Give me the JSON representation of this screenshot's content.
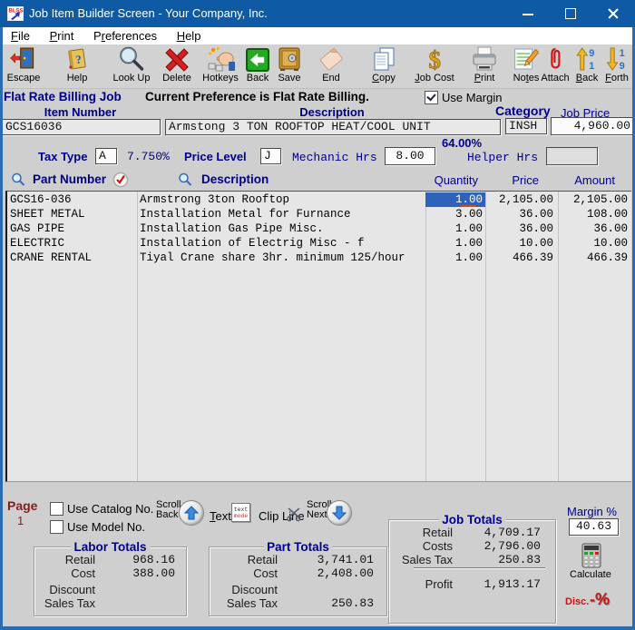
{
  "titlebar": {
    "icon_text": "BLSS",
    "title": "Job Item Builder Screen - Your Company, Inc."
  },
  "menubar": {
    "items": [
      {
        "pre": "",
        "u": "F",
        "post": "ile"
      },
      {
        "pre": "",
        "u": "P",
        "post": "rint"
      },
      {
        "pre": "P",
        "u": "r",
        "post": "eferences"
      },
      {
        "pre": "",
        "u": "H",
        "post": "elp"
      }
    ]
  },
  "toolbar": {
    "items": [
      {
        "icon": "escape-door",
        "pre": "Escape",
        "u": "",
        "post": ""
      },
      {
        "icon": "help-book",
        "pre": "Help",
        "u": "",
        "post": ""
      },
      {
        "icon": "magnifier",
        "pre": "Look Up",
        "u": "",
        "post": ""
      },
      {
        "icon": "delete-x",
        "pre": "Delete",
        "u": "",
        "post": ""
      },
      {
        "icon": "hotkeys-hand",
        "pre": "Hotkeys",
        "u": "",
        "post": ""
      },
      {
        "icon": "back-green-arrow",
        "pre": "Back",
        "u": "",
        "post": ""
      },
      {
        "icon": "safe",
        "pre": "Save",
        "u": "",
        "post": ""
      },
      {
        "icon": "end-page",
        "pre": "End",
        "u": "",
        "post": ""
      },
      {
        "icon": "copy-docs",
        "pre": "",
        "u": "C",
        "post": "opy"
      },
      {
        "icon": "dollar",
        "pre": "",
        "u": "J",
        "post": "ob Cost"
      },
      {
        "icon": "printer",
        "pre": "",
        "u": "P",
        "post": "rint"
      },
      {
        "icon": "notes-pad",
        "pre": "No",
        "u": "t",
        "post": "es"
      },
      {
        "icon": "paperclip",
        "pre": "Attach",
        "u": "",
        "post": ""
      },
      {
        "icon": "numeric-up",
        "pre": "",
        "u": "B",
        "post": "ack"
      },
      {
        "icon": "numeric-down",
        "pre": "",
        "u": "F",
        "post": "orth"
      }
    ]
  },
  "banner": {
    "mode": "Flat Rate Billing Job",
    "message": "Current Preference is Flat Rate Billing.",
    "use_margin_label": "Use Margin",
    "use_margin_checked": true
  },
  "item": {
    "item_number_label": "Item Number",
    "item_number": "GCS16036",
    "description_label": "Description",
    "description": "Armstong 3 TON ROOFTOP HEAT/COOL UNIT",
    "category_label": "Category",
    "category": "INSH",
    "job_price_label": "Job Price",
    "job_price": "4,960.00",
    "margin_pct": "64.00%",
    "tax_type_label": "Tax Type",
    "tax_type": "A",
    "tax_rate": "7.750%",
    "price_level_label": "Price Level",
    "price_level": "J",
    "mechanic_hrs_label": "Mechanic Hrs",
    "mechanic_hrs": "8.00",
    "helper_hrs_label": "Helper Hrs",
    "helper_hrs": ""
  },
  "table": {
    "headers": {
      "part": "Part Number",
      "desc": "Description",
      "qty": "Quantity",
      "price": "Price",
      "amount": "Amount"
    },
    "rows": [
      {
        "part": "GCS16-036",
        "desc": "Armstrong 3ton Rooftop",
        "qty": "1.00",
        "price": "2,105.00",
        "amount": "2,105.00",
        "selected": true
      },
      {
        "part": "SHEET METAL",
        "desc": "Installation Metal for Furnance",
        "qty": "3.00",
        "price": "36.00",
        "amount": "108.00",
        "selected": false
      },
      {
        "part": "GAS PIPE",
        "desc": "Installation Gas Pipe Misc.",
        "qty": "1.00",
        "price": "36.00",
        "amount": "36.00",
        "selected": false
      },
      {
        "part": "ELECTRIC",
        "desc": "Installation of Electrig Misc - f",
        "qty": "1.00",
        "price": "10.00",
        "amount": "10.00",
        "selected": false
      },
      {
        "part": "CRANE RENTAL",
        "desc": "Tiyal Crane share 3hr. minimum 125/hour",
        "qty": "1.00",
        "price": "466.39",
        "amount": "466.39",
        "selected": false
      }
    ]
  },
  "footer": {
    "page_label": "Page",
    "page_number": "1",
    "use_catalog_label": "Use Catalog No.",
    "use_model_label": "Use Model No.",
    "scroll_back_line1": "Scroll",
    "scroll_back_line2": "Back",
    "text_label": {
      "pre": "",
      "u": "T",
      "post": "ext"
    },
    "text_mode_icon_line1": "text",
    "text_mode_icon_line2": "mode",
    "clip_line_label": "Clip Line",
    "scroll_next_line1": "Scroll",
    "scroll_next_line2": "Next",
    "labor": {
      "title": "Labor Totals",
      "rows": [
        [
          "Retail",
          "968.16"
        ],
        [
          "Cost",
          "388.00"
        ],
        [
          "Discount",
          ""
        ],
        [
          "Sales Tax",
          ""
        ]
      ]
    },
    "part": {
      "title": "Part Totals",
      "rows": [
        [
          "Retail",
          "3,741.01"
        ],
        [
          "Cost",
          "2,408.00"
        ],
        [
          "Discount",
          ""
        ],
        [
          "Sales Tax",
          "250.83"
        ]
      ]
    },
    "job": {
      "title": "Job Totals",
      "rows": [
        [
          "Retail",
          "4,709.17"
        ],
        [
          "Costs",
          "2,796.00"
        ],
        [
          "Sales Tax",
          "250.83"
        ]
      ],
      "profit_label": "Profit",
      "profit_value": "1,913.17"
    },
    "margin_label": "Margin %",
    "margin_value": "40.63",
    "calculate_label": "Calculate",
    "disc_label": "Disc.",
    "disc_symbol": "-%"
  },
  "colors": {
    "titlebar_blue": "#0f5aa5",
    "label_navy": "#00008b",
    "page_maroon": "#8b1a1a",
    "selection_blue": "#2e63bc",
    "accent_red": "#cc1111",
    "form_gray": "#cfcfcf",
    "table_bg": "#e6e6e6"
  }
}
